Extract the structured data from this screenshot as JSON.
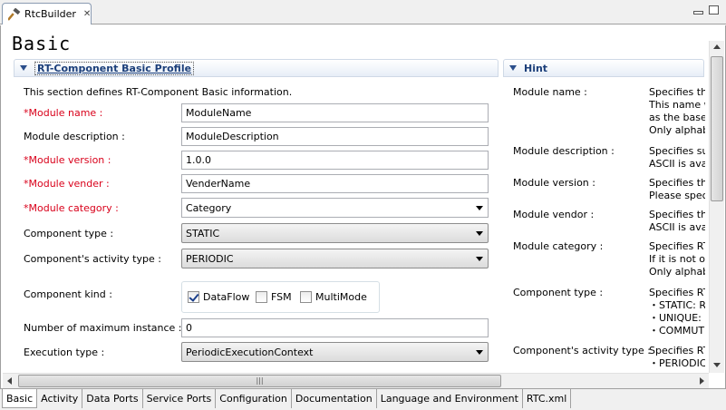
{
  "editor": {
    "tab_title": "RtcBuilder",
    "page_title": "Basic"
  },
  "basic_section": {
    "title": "RT-Component Basic Profile",
    "description": "This section defines RT-Component Basic information.",
    "fields": {
      "module_name": {
        "label": "*Module name :",
        "value": "ModuleName"
      },
      "module_description": {
        "label": "Module description :",
        "value": "ModuleDescription"
      },
      "module_version": {
        "label": "*Module version :",
        "value": "1.0.0"
      },
      "module_vender": {
        "label": "*Module vender :",
        "value": "VenderName"
      },
      "module_category": {
        "label": "*Module category :",
        "value": "Category"
      },
      "component_type": {
        "label": "Component type :",
        "value": "STATIC"
      },
      "activity_type": {
        "label": "Component's activity type :",
        "value": "PERIODIC"
      },
      "component_kind": {
        "label": "Component kind :",
        "options": [
          {
            "label": "DataFlow",
            "checked": true
          },
          {
            "label": "FSM",
            "checked": false
          },
          {
            "label": "MultiMode",
            "checked": false
          }
        ]
      },
      "max_instance": {
        "label": "Number of maximum instance :",
        "value": "0"
      },
      "execution_type": {
        "label": "Execution type :",
        "value": "PeriodicExecutionContext"
      }
    }
  },
  "hint_section": {
    "title": "Hint",
    "items": [
      {
        "label": "Module name :",
        "lines": [
          "Specifies the",
          "This name w",
          "as the base i",
          "Only alphab"
        ]
      },
      {
        "label": "Module description :",
        "lines": [
          "Specifies su",
          "ASCII is avai"
        ]
      },
      {
        "label": "Module version :",
        "lines": [
          "Specifies the",
          "Please speci"
        ]
      },
      {
        "label": "Module vendor :",
        "lines": [
          "Specifies the",
          "ASCII is avai"
        ]
      },
      {
        "label": "Module category :",
        "lines": [
          "Specifies RT",
          "If it is not o",
          "Only alphab"
        ]
      },
      {
        "label": "Component type :",
        "lines": [
          "Specifies RT",
          " ・STATIC: R",
          " ・UNIQUE: U",
          " ・COMMUT"
        ]
      },
      {
        "label": "Component's activity type :",
        "lines": [
          "Specifies RT",
          " ・PERIODIC:"
        ]
      }
    ]
  },
  "page_tabs": [
    "Basic",
    "Activity",
    "Data Ports",
    "Service Ports",
    "Configuration",
    "Documentation",
    "Language and Environment",
    "RTC.xml"
  ],
  "colors": {
    "required_label": "#d9001a",
    "section_title": "#1c3f7a"
  }
}
